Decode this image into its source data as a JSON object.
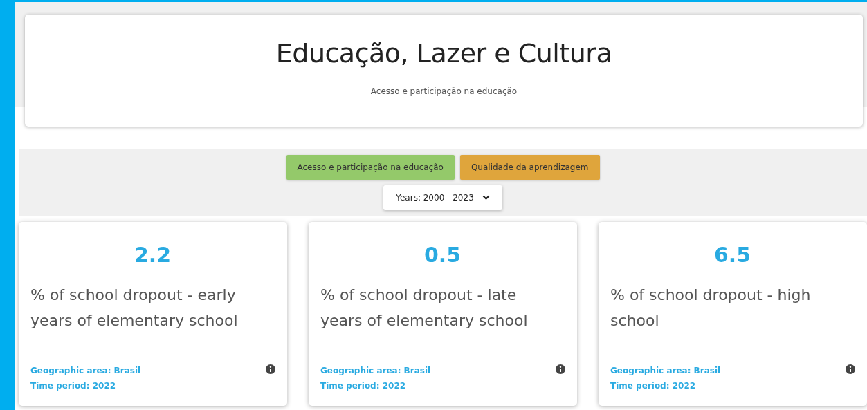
{
  "header": {
    "title": "Educação, Lazer e Cultura",
    "subtitle": "Acesso e participação na educação"
  },
  "topics": [
    {
      "label": "Acesso e participação na educação",
      "color": "#94c96a"
    },
    {
      "label": "Qualidade da aprendizagem",
      "color": "#dfa53c"
    }
  ],
  "years_filter": {
    "label": "Years: 2000 - 2023"
  },
  "indicators": [
    {
      "value": "2.2",
      "title": "% of school dropout - early years of elementary school",
      "area": "Geographic area: Brasil",
      "period": "Time period: 2022"
    },
    {
      "value": "0.5",
      "title": "% of school dropout - late years of elementary school",
      "area": "Geographic area: Brasil",
      "period": "Time period: 2022"
    },
    {
      "value": "6.5",
      "title": "% of school dropout - high school",
      "area": "Geographic area: Brasil",
      "period": "Time period: 2022"
    }
  ]
}
